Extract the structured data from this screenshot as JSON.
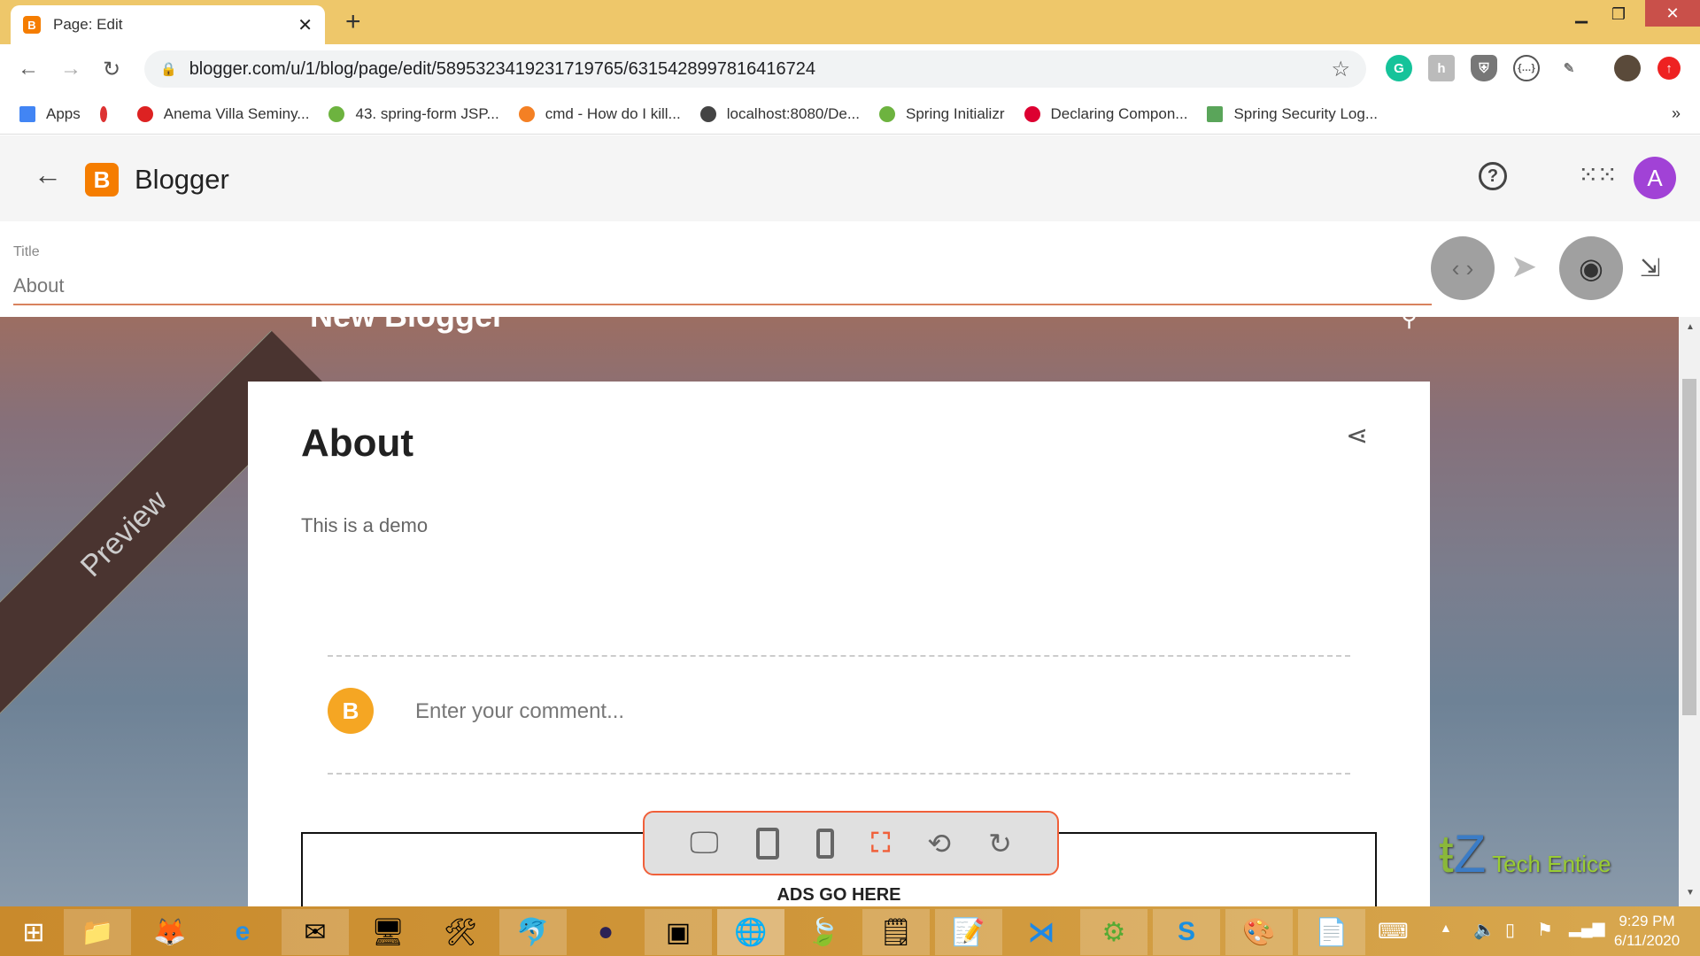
{
  "browser": {
    "tab_title": "Page: Edit",
    "url": "blogger.com/u/1/blog/page/edit/5895323419231719765/6315428997816416724",
    "bookmarks": [
      {
        "label": "Apps",
        "color": "#4285f4"
      },
      {
        "label": "",
        "color": "#d33"
      },
      {
        "label": "Anema Villa Seminy...",
        "color": "#d22"
      },
      {
        "label": "43. spring-form JSP...",
        "color": "#6db33f"
      },
      {
        "label": "cmd - How do I kill...",
        "color": "#f48024"
      },
      {
        "label": "localhost:8080/De...",
        "color": "#444"
      },
      {
        "label": "Spring Initializr",
        "color": "#6db33f"
      },
      {
        "label": "Declaring Compon...",
        "color": "#dd0031"
      },
      {
        "label": "Spring Security Log...",
        "color": "#5aa55a"
      }
    ],
    "more_bookmarks": "»"
  },
  "blogger": {
    "app_name": "Blogger",
    "avatar_letter": "A",
    "accent": "#f57d00",
    "avatar_color": "#a142d6"
  },
  "editor": {
    "title_label": "Title",
    "title_value": "About"
  },
  "preview": {
    "ribbon": "Preview",
    "blog_header": "New Blogger",
    "post_title": "About",
    "post_body": "This is a demo",
    "comment_placeholder": "Enter your comment...",
    "ads_text": "ADS GO HERE",
    "watermark": "Tech Entice"
  },
  "taskbar": {
    "time": "9:29 PM",
    "date": "6/11/2020"
  }
}
